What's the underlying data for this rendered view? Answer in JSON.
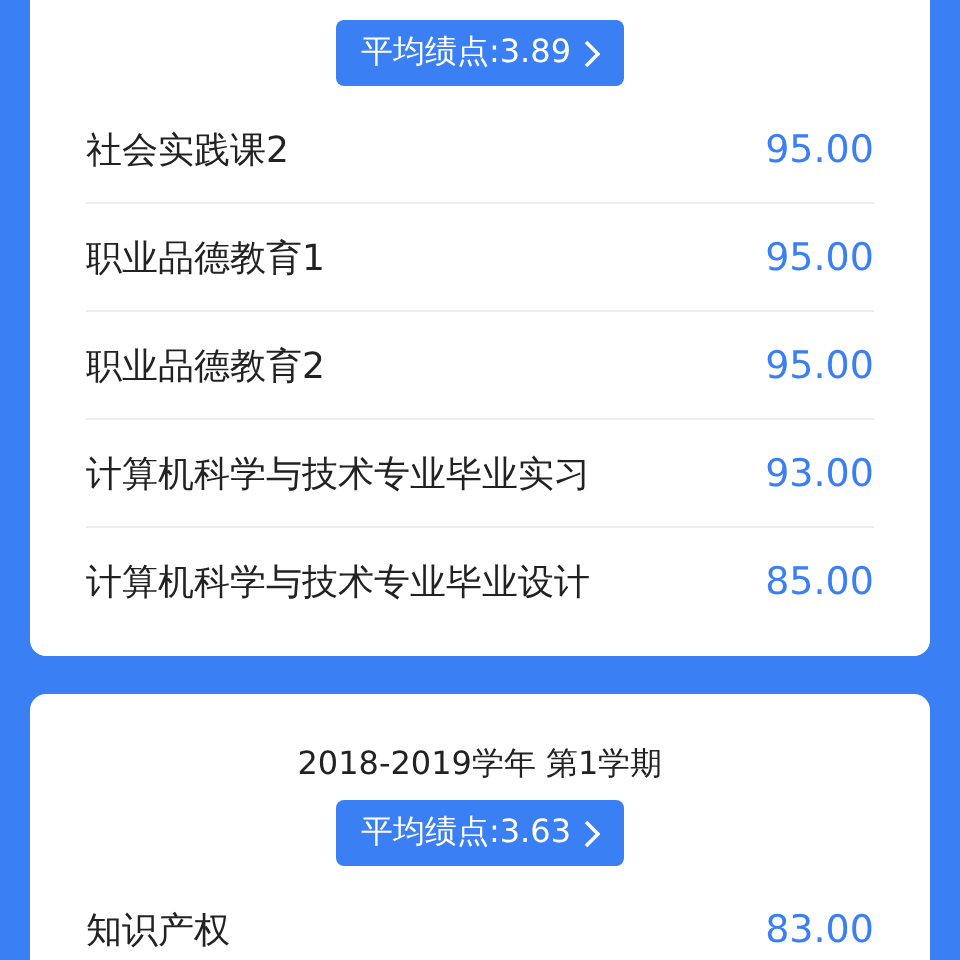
{
  "semesters": [
    {
      "gpa_button": "平均绩点:3.89",
      "courses": [
        {
          "name": "社会实践课2",
          "score": "95.00"
        },
        {
          "name": "职业品德教育1",
          "score": "95.00"
        },
        {
          "name": "职业品德教育2",
          "score": "95.00"
        },
        {
          "name": "计算机科学与技术专业毕业实习",
          "score": "93.00"
        },
        {
          "name": "计算机科学与技术专业毕业设计",
          "score": "85.00"
        }
      ]
    },
    {
      "title": "2018-2019学年 第1学期",
      "gpa_button": "平均绩点:3.63",
      "courses": [
        {
          "name": "知识产权",
          "score": "83.00"
        }
      ]
    }
  ]
}
